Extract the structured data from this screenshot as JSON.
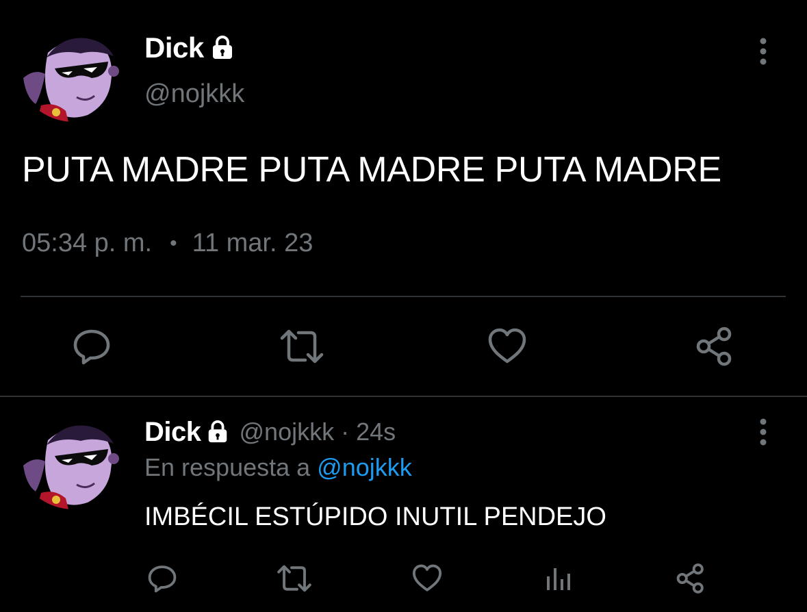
{
  "main_tweet": {
    "author_name": "Dick",
    "author_handle": "@nojkkk",
    "text": "PUTA MADRE PUTA MADRE PUTA MADRE",
    "time": "05:34 p. m.",
    "dot": "•",
    "date": "11 mar. 23",
    "actions": [
      "reply-icon",
      "retweet-icon",
      "like-icon",
      "share-icon"
    ]
  },
  "reply_tweet": {
    "author_name": "Dick",
    "author_handle": "@nojkkk",
    "separator": "·",
    "time_ago": "24s",
    "reply_prefix": "En respuesta a",
    "reply_to_handle": "@nojkkk",
    "text": "IMBÉCIL ESTÚPIDO INUTIL PENDEJO",
    "actions": [
      "reply-icon",
      "retweet-icon",
      "like-icon",
      "analytics-icon",
      "share-icon"
    ]
  },
  "colors": {
    "background": "#000000",
    "text_primary": "#e7e9ea",
    "text_secondary": "#71767b",
    "link": "#1d9bf0",
    "divider": "#2f3336"
  }
}
